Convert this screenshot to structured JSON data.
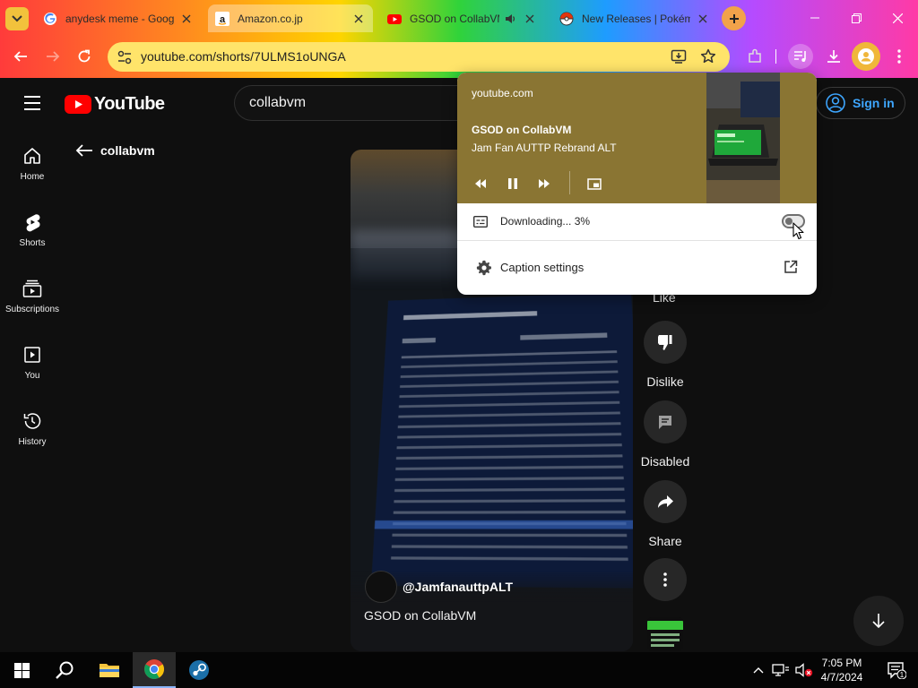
{
  "browser": {
    "tabs": [
      {
        "title": "anydesk meme - Goog",
        "favicon": "google-g-icon",
        "active": false
      },
      {
        "title": "Amazon.co.jp",
        "favicon": "amazon-icon",
        "active": true
      },
      {
        "title": "GSOD on CollabVM",
        "favicon": "youtube-icon",
        "active": false,
        "audio": true
      },
      {
        "title": "New Releases | Pokém",
        "favicon": "pokeball-icon",
        "active": false
      }
    ],
    "url": "youtube.com/shorts/7ULMS1oUNGA"
  },
  "youtube": {
    "logo_text": "YouTube",
    "search_value": "collabvm",
    "sign_in": "Sign in",
    "back_label": "collabvm",
    "sidebar": [
      {
        "label": "Home",
        "icon": "home-icon"
      },
      {
        "label": "Shorts",
        "icon": "shorts-icon"
      },
      {
        "label": "Subscriptions",
        "icon": "subscriptions-icon"
      },
      {
        "label": "You",
        "icon": "you-icon"
      },
      {
        "label": "History",
        "icon": "history-icon"
      }
    ],
    "short": {
      "channel": "@JamfanauttpALT",
      "title": "GSOD on CollabVM"
    },
    "actions": {
      "like": "Like",
      "dislike": "Dislike",
      "comments": "Disabled",
      "share": "Share"
    }
  },
  "media_popup": {
    "origin": "youtube.com",
    "title": "GSOD on CollabVM",
    "artist": "Jam Fan AUTTP Rebrand ALT",
    "live_caption_status": "Downloading... 3%",
    "caption_settings": "Caption settings",
    "toggle_on": false
  },
  "taskbar": {
    "time": "7:05 PM",
    "date": "4/7/2024",
    "notification_count": "1"
  },
  "colors": {
    "youtube_red": "#ff0000",
    "link_blue": "#3ea6ff",
    "popup_media_bg": "#8a7533"
  }
}
